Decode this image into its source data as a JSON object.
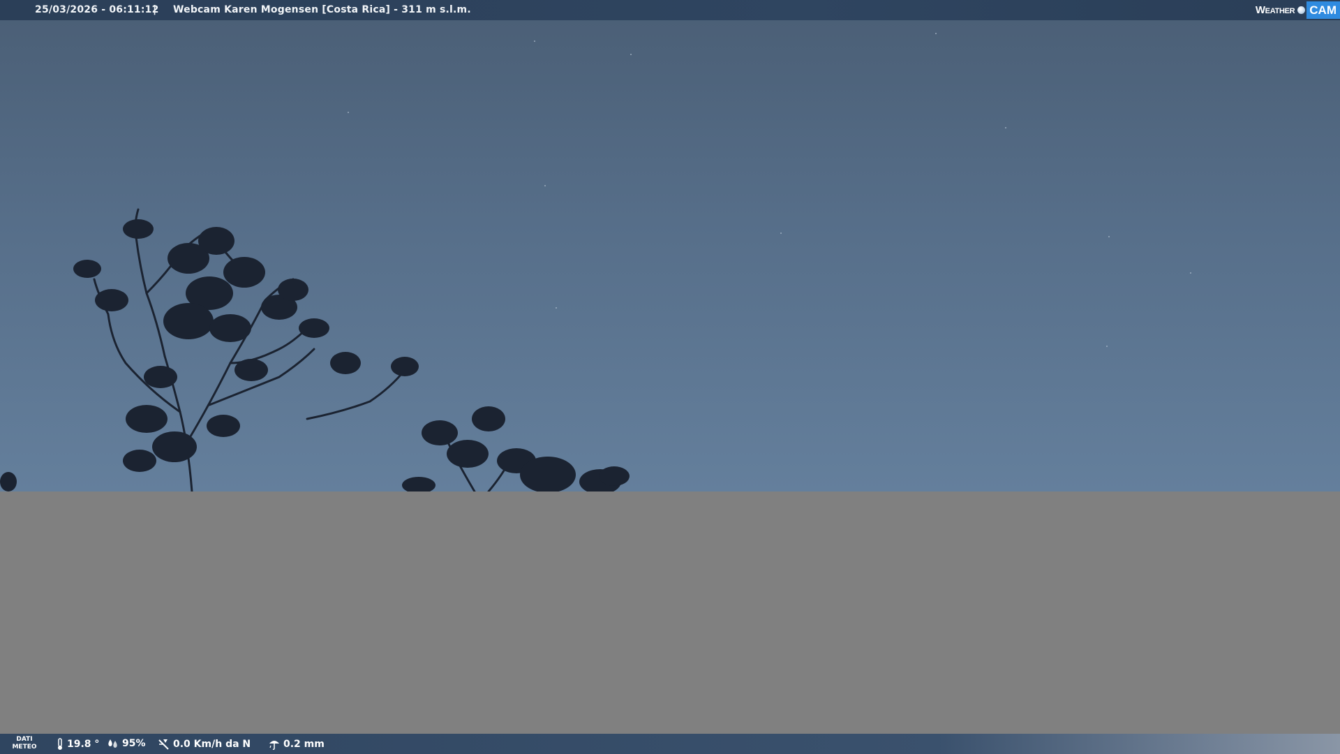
{
  "top_bar": {
    "datetime": "25/03/2026 - 06:11:12",
    "separator": "|",
    "title": "Webcam Karen Mogensen [Costa Rica]  - 311 m s.l.m."
  },
  "logo": {
    "weather_text": "Weather",
    "cam_text": "CAM"
  },
  "weather_data": {
    "label_line1": "DATI",
    "label_line2": "METEO",
    "temperature": "19.8 °",
    "humidity": "95%",
    "wind": "0.0 Km/h da N",
    "rain": "0.2 mm"
  },
  "icons": {
    "temperature": "thermometer-icon",
    "humidity": "humidity-drops-icon",
    "wind": "wind-icon",
    "rain": "rain-icon",
    "logo": "globe-icon"
  },
  "colors": {
    "bar": "#2f4560",
    "logo_cam": "#2f8be0",
    "sky": "#566e89",
    "gray": "#808080"
  }
}
